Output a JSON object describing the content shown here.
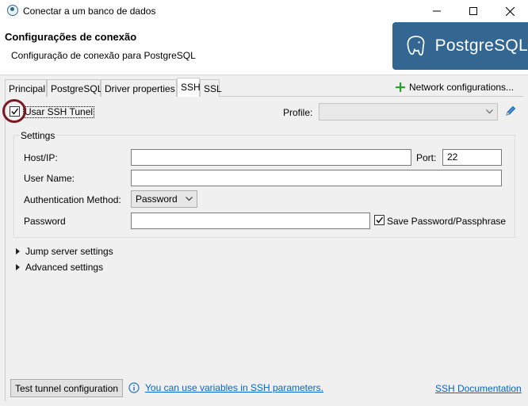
{
  "window": {
    "title": "Conectar a um banco de dados"
  },
  "header": {
    "title": "Configurações de conexão",
    "subtitle": "Configuração de conexão para PostgreSQL",
    "logo_text": "PostgreSQL"
  },
  "tabs": [
    "Principal",
    "PostgreSQL",
    "Driver properties",
    "SSH",
    "SSL"
  ],
  "active_tab": "SSH",
  "network_config_label": "Network configurations...",
  "ssh": {
    "use_ssh_label": "Usar SSH Tunel",
    "use_ssh_checked": true,
    "profile_label": "Profile:",
    "profile_value": "",
    "settings_title": "Settings",
    "host_label": "Host/IP:",
    "host_value": "",
    "port_label": "Port:",
    "port_value": "22",
    "user_label": "User Name:",
    "user_value": "",
    "auth_label": "Authentication Method:",
    "auth_value": "Password",
    "password_label": "Password",
    "password_value": "",
    "save_password_label": "Save Password/Passphrase",
    "save_password_checked": true,
    "jump_label": "Jump server settings",
    "advanced_label": "Advanced settings"
  },
  "footer": {
    "test_button": "Test tunnel configuration",
    "variables_link": "You can use variables in SSH parameters.",
    "docs_link": "SSH Documentation"
  },
  "colors": {
    "accent": "#336791",
    "link": "#0066cc",
    "highlight_circle": "#7a1a22",
    "plus_icon": "#2e9e2e"
  }
}
